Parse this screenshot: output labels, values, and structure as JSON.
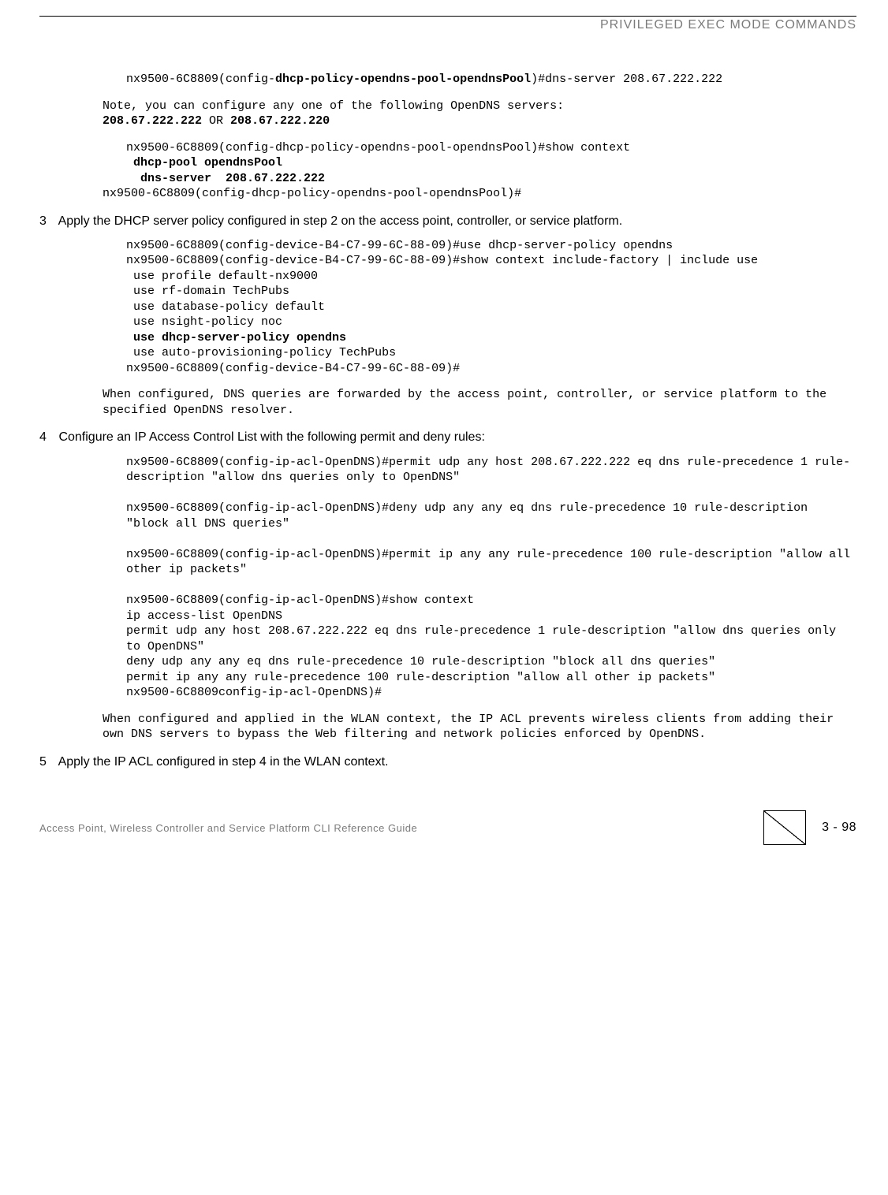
{
  "header": {
    "title": "PRIVILEGED EXEC MODE COMMANDS"
  },
  "blocks": {
    "b1a": "nx9500-6C8809(config-",
    "b1b": "dhcp-policy-opendns-pool-opendnsPool",
    "b1c": ")#dns-server 208.67.222.222",
    "b2a": "Note, you can configure any one of the following OpenDNS servers: ",
    "b2b": "208.67.222.222",
    "b2c": " OR ",
    "b2d": "208.67.222.220",
    "b3a": "nx9500-6C8809(config-dhcp-policy-opendns-pool-opendnsPool)#show context",
    "b3b": " dhcp-pool opendnsPool",
    "b3c": "  dns-server  208.67.222.222",
    "b3d": "nx9500-6C8809(config-dhcp-policy-opendns-pool-opendnsPool)#",
    "step3": "Apply the DHCP server policy configured in step 2 on the access point, controller, or service platform.",
    "b4a": "nx9500-6C8809(config-device-B4-C7-99-6C-88-09)#use dhcp-server-policy opendns",
    "b4b": "nx9500-6C8809(config-device-B4-C7-99-6C-88-09)#show context include-factory | include use",
    "b4c": " use profile default-nx9000",
    "b4d": " use rf-domain TechPubs",
    "b4e": " use database-policy default",
    "b4f": " use nsight-policy noc",
    "b4g": " use dhcp-server-policy opendns",
    "b4h": " use auto-provisioning-policy TechPubs",
    "b4i": "nx9500-6C8809(config-device-B4-C7-99-6C-88-09)#",
    "b5": "When configured, DNS queries are forwarded by the access point, controller, or service platform to the specified OpenDNS resolver.",
    "step4": "Configure an IP Access Control List with the following permit and deny rules:",
    "b6a": "nx9500-6C8809(config-ip-acl-OpenDNS)#permit udp any host 208.67.222.222 eq dns rule-precedence 1 rule-description \"allow dns queries only to OpenDNS\"",
    "b6b": "nx9500-6C8809(config-ip-acl-OpenDNS)#deny udp any any eq dns rule-precedence 10 rule-description \"block all DNS queries\"",
    "b6c": "nx9500-6C8809(config-ip-acl-OpenDNS)#permit ip any any rule-precedence 100 rule-description \"allow all other ip packets\"",
    "b6d": "nx9500-6C8809(config-ip-acl-OpenDNS)#show context",
    "b6e": "ip access-list OpenDNS",
    "b6f": "permit udp any host 208.67.222.222 eq dns rule-precedence 1 rule-description \"allow dns queries only to OpenDNS\"",
    "b6g": "deny udp any any eq dns rule-precedence 10 rule-description \"block all dns queries\"",
    "b6h": "permit ip any any rule-precedence 100 rule-description \"allow all other ip packets\"",
    "b6i": "nx9500-6C8809config-ip-acl-OpenDNS)#",
    "b7": "When configured and applied in the WLAN context, the IP ACL prevents wireless clients from adding their own DNS servers to bypass the Web filtering and network policies enforced by OpenDNS.",
    "step5": "Apply the IP ACL configured in step 4 in the WLAN context."
  },
  "footer": {
    "left": "Access Point, Wireless Controller and Service Platform CLI Reference Guide",
    "pagenum": "3 - 98"
  }
}
